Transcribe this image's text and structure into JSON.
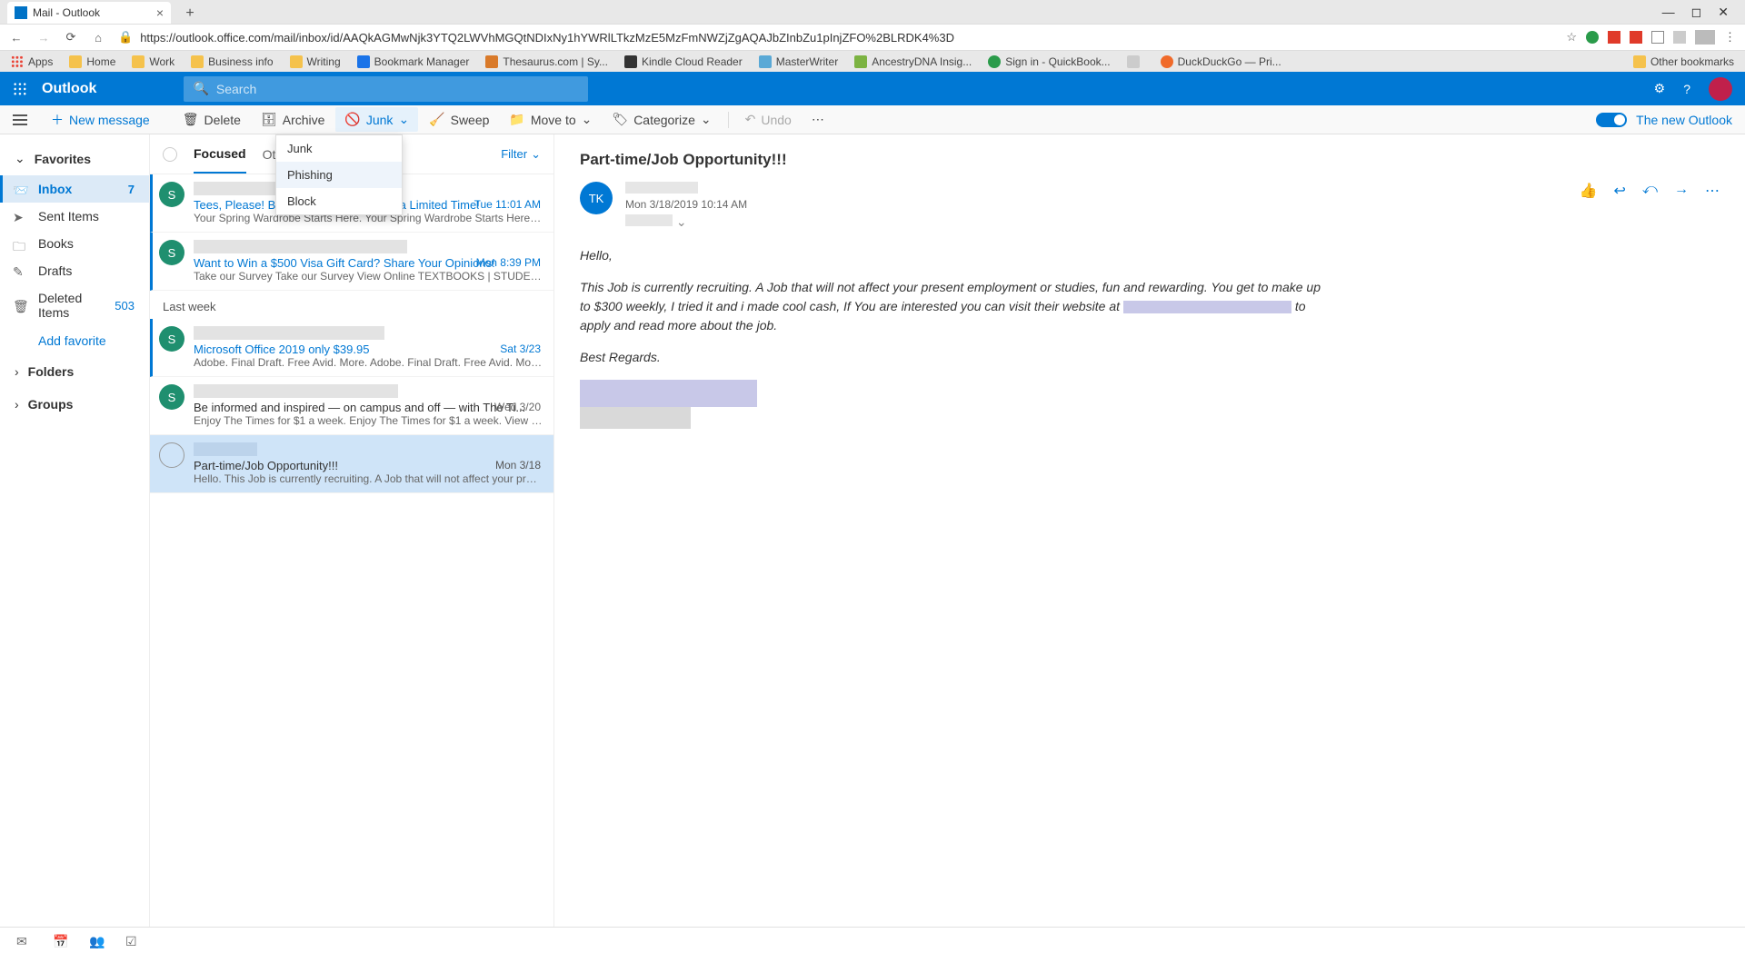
{
  "browser": {
    "tab_title": "Mail -                    Outlook",
    "url": "https://outlook.office.com/mail/inbox/id/AAQkAGMwNjk3YTQ2LWVhMGQtNDIxNy1hYWRlLTkzMzE5MzFmNWZjZgAQAJbZInbZu1pInjZFO%2BLRDK4%3D",
    "bookmarks_bar": {
      "apps": "Apps",
      "items": [
        "Home",
        "Work",
        "Business info",
        "Writing",
        "Bookmark Manager",
        "Thesaurus.com | Sy...",
        "Kindle Cloud Reader",
        "MasterWriter",
        "AncestryDNA Insig...",
        "Sign in - QuickBook...",
        "",
        "DuckDuckGo — Pri..."
      ],
      "other": "Other bookmarks"
    }
  },
  "header": {
    "brand": "Outlook",
    "search_placeholder": "Search"
  },
  "toolbar": {
    "new_message": "New message",
    "delete": "Delete",
    "archive": "Archive",
    "junk": "Junk",
    "sweep": "Sweep",
    "move_to": "Move to",
    "categorize": "Categorize",
    "undo": "Undo",
    "new_outlook_label": "The new Outlook"
  },
  "junk_menu": {
    "junk": "Junk",
    "phishing": "Phishing",
    "block": "Block"
  },
  "nav": {
    "favorites": "Favorites",
    "inbox": "Inbox",
    "inbox_count": "7",
    "sent": "Sent Items",
    "books": "Books",
    "drafts": "Drafts",
    "deleted": "Deleted Items",
    "deleted_count": "503",
    "add_favorite": "Add favorite",
    "folders": "Folders",
    "groups": "Groups"
  },
  "list": {
    "tab_focused": "Focused",
    "tab_other": "Other",
    "filter": "Filter",
    "section_lastweek": "Last week",
    "messages": [
      {
        "subject": "Tees, Please! Buy 1, Get 1 50% Off for a Limited Time!",
        "preview": "Your Spring Wardrobe Starts Here. Your Spring Wardrobe Starts Here. View Onl...",
        "time": "Tue 11:01 AM",
        "avatar": "S"
      },
      {
        "subject": "Want to Win a $500 Visa Gift Card? Share Your Opinions!",
        "preview": "Take our Survey Take our Survey View Online TEXTBOOKS | STUDENT OFFERS | ...",
        "time": "Mon 8:39 PM",
        "avatar": "S"
      },
      {
        "subject": "Microsoft Office 2019 only $39.95",
        "preview": "Adobe. Final Draft. Free Avid. More. Adobe. Final Draft. Free Avid. More. View ...",
        "time": "Sat 3/23",
        "avatar": "S"
      },
      {
        "subject": "Be informed and inspired — on campus and off — with The Ti...",
        "preview": "Enjoy The Times for $1 a week. Enjoy The Times for $1 a week. View Online TEX...",
        "time": "Wed 3/20",
        "avatar": "S"
      },
      {
        "subject": "Part-time/Job Opportunity!!!",
        "preview": "Hello. This Job is currently recruiting. A Job that will not affect your present em...",
        "time": "Mon 3/18",
        "avatar": ""
      }
    ]
  },
  "reading": {
    "subject": "Part-time/Job Opportunity!!!",
    "avatar_initials": "TK",
    "date": "Mon 3/18/2019 10:14 AM",
    "body_hello": "Hello,",
    "body_para": "This Job is currently recruiting.  A Job that will not affect your present employment or studies, fun and rewarding.  You get to make up to $300 weekly, I tried it and i made cool cash, If You are interested you can visit their website at ",
    "body_para_tail": "to apply and read more about the job.",
    "regards": "Best Regards."
  }
}
